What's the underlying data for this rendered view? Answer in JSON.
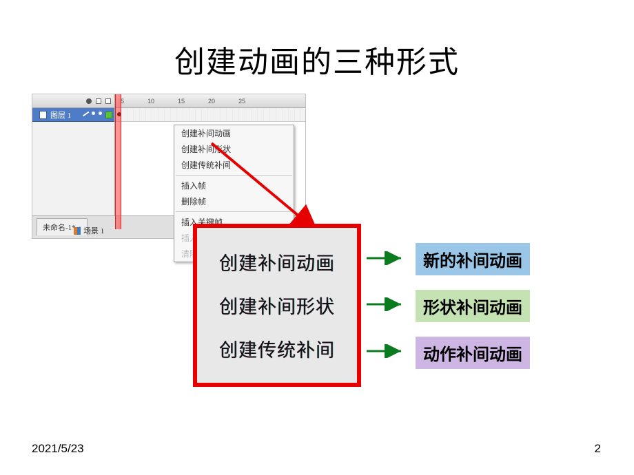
{
  "slide": {
    "title": "创建动画的三种形式",
    "date": "2021/5/23",
    "page": "2"
  },
  "timeline": {
    "ruler": [
      "5",
      "10",
      "15",
      "20",
      "25"
    ],
    "layer_name": "图层 1",
    "doc_tab": "未命名-1*",
    "scene_tab": "场景 1"
  },
  "context_menu": {
    "items_top": [
      "创建补间动画",
      "创建补间形状",
      "创建传统补间"
    ],
    "items_mid": [
      "插入帧",
      "删除帧"
    ],
    "items_bot_1": "插入关键帧",
    "items_bot_2": "插入空白关键帧",
    "items_bot_3": "清除"
  },
  "highlight": {
    "item1": "创建补间动画",
    "item2": "创建补间形状",
    "item3": "创建传统补间"
  },
  "tags": {
    "blue": "新的补间动画",
    "green": "形状补间动画",
    "purple": "动作补间动画"
  }
}
